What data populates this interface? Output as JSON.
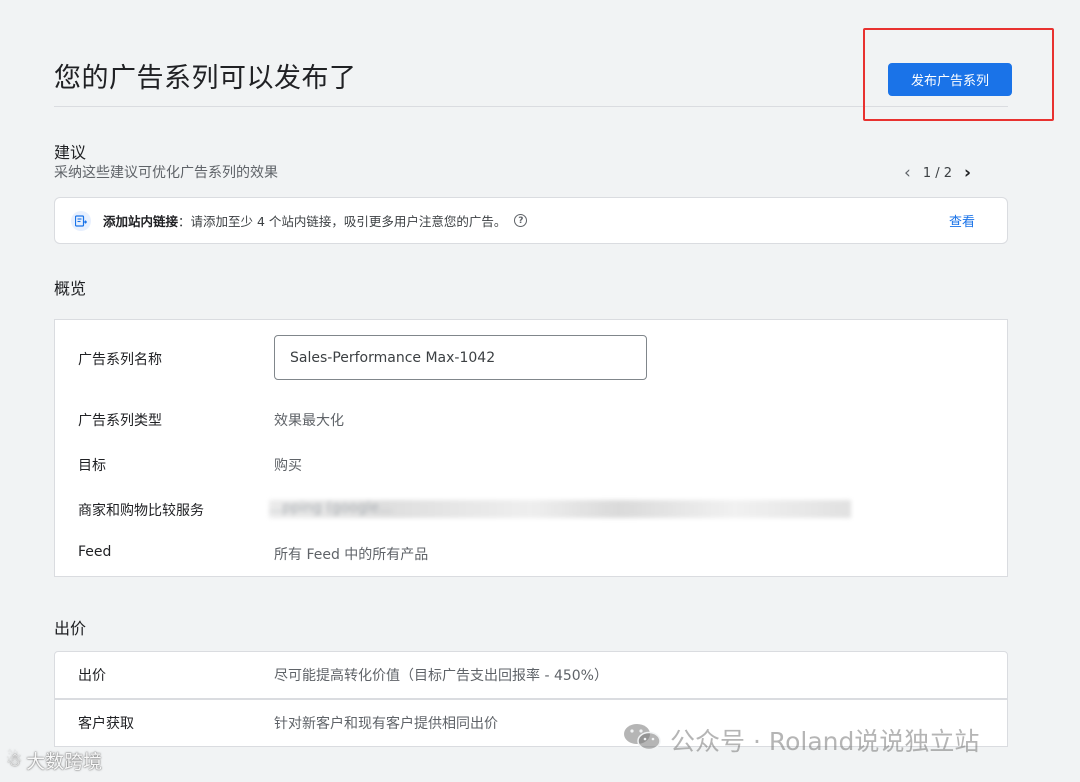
{
  "header": {
    "title": "您的广告系列可以发布了",
    "publish_label": "发布广告系列"
  },
  "suggestions": {
    "heading": "建议",
    "subtitle": "采纳这些建议可优化广告系列的效果",
    "pager": "1 / 2",
    "card": {
      "icon": "sitelink-icon",
      "bold_label": "添加站内链接",
      "text": "：请添加至少 4 个站内链接，吸引更多用户注意您的广告。",
      "view_label": "查看"
    }
  },
  "overview": {
    "heading": "概览",
    "rows": [
      {
        "label": "广告系列名称",
        "value": "Sales-Performance Max-1042"
      },
      {
        "label": "广告系列类型",
        "value": "效果最大化"
      },
      {
        "label": "目标",
        "value": "购买"
      },
      {
        "label": "商家和购物比较服务",
        "value": "...pping (google..."
      },
      {
        "label": "Feed",
        "value": "所有 Feed 中的所有产品"
      }
    ]
  },
  "bidding": {
    "heading": "出价",
    "rows": [
      {
        "label": "出价",
        "value": "尽可能提高转化价值（目标广告支出回报率 - 450%）"
      },
      {
        "label": "客户获取",
        "value": "针对新客户和现有客户提供相同出价"
      }
    ]
  },
  "watermarks": {
    "right": "公众号 · Roland说说独立站",
    "left": "大数跨境"
  },
  "colors": {
    "accent": "#1a73e8",
    "highlight": "#e8312f",
    "background": "#f1f3f4"
  }
}
